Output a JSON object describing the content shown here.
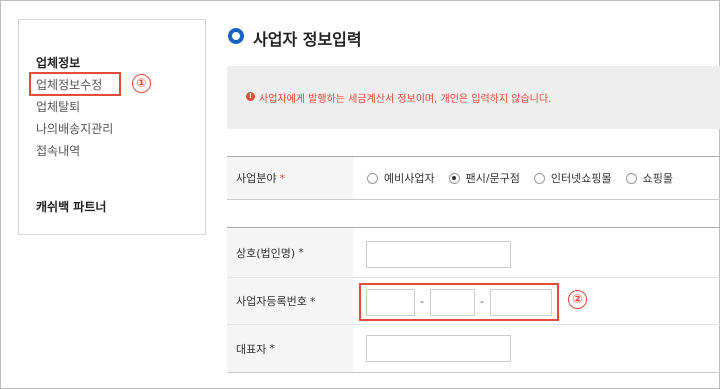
{
  "sidebar": {
    "title": "업체정보",
    "items": [
      "업체정보수정",
      "업체탈퇴",
      "나의배송지관리",
      "접속내역"
    ],
    "partner": "캐쉬백 파트너",
    "annotation": "①"
  },
  "main": {
    "title": "사업자 정보입력",
    "notice": "사업자에게 발행하는 세금계산서 정보이며, 개인은 입력하지 않습니다.",
    "business_field": {
      "label": "사업분야",
      "required_mark": "*",
      "options": [
        "예비사업자",
        "팬시/문구점",
        "인터넷쇼핑몰",
        "쇼핑몰"
      ],
      "selected": "팬시/문구점"
    },
    "company_name": {
      "label": "상호(법인명)",
      "required_mark": "*",
      "value": ""
    },
    "business_number": {
      "label": "사업자등록번호",
      "required_mark": "*",
      "part1": "",
      "part2": "",
      "part3": "",
      "separator": "-"
    },
    "ceo": {
      "label": "대표자",
      "required_mark": "*",
      "value": ""
    },
    "annotation": "②"
  },
  "colors": {
    "accent": "#1565c0",
    "highlight": "#e44b3a"
  }
}
